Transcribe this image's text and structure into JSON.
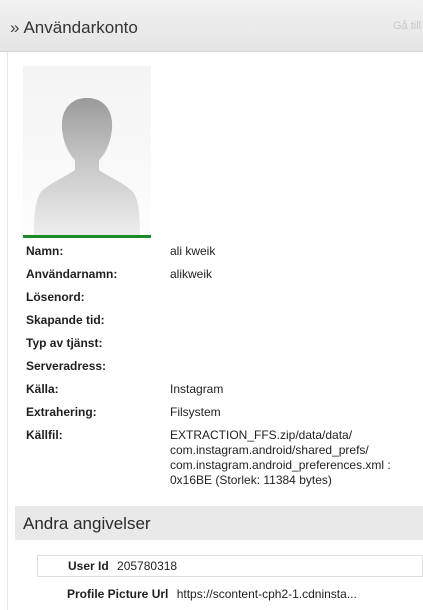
{
  "header": {
    "title": "Användarkonto",
    "link_text": "Gå till"
  },
  "avatar": {
    "icon": "default-user-silhouette"
  },
  "properties": [
    {
      "label": "Namn:",
      "value": "ali kweik"
    },
    {
      "label": "Användarnamn:",
      "value": "alikweik"
    },
    {
      "label": "Lösenord:",
      "value": ""
    },
    {
      "label": "Skapande tid:",
      "value": ""
    },
    {
      "label": "Typ av tjänst:",
      "value": ""
    },
    {
      "label": "Serveradress:",
      "value": ""
    },
    {
      "label": "Källa:",
      "value": "Instagram"
    },
    {
      "label": "Extrahering:",
      "value": "Filsystem"
    },
    {
      "label": "Källfil:",
      "value": "EXTRACTION_FFS.zip/data/data/\ncom.instagram.android/shared_prefs/\ncom.instagram.android_preferences.xml :\n0x16BE (Storlek: 11384 bytes)"
    }
  ],
  "other_section": {
    "title": "Andra angivelser",
    "items": [
      {
        "label": "User Id",
        "value": "205780318"
      },
      {
        "label": "Profile Picture Url",
        "value": "https://scontent-cph2-1.cdninsta..."
      }
    ]
  },
  "colors": {
    "accent_bar": "#1b8a2a",
    "header_bg": "#e9e9e9"
  }
}
